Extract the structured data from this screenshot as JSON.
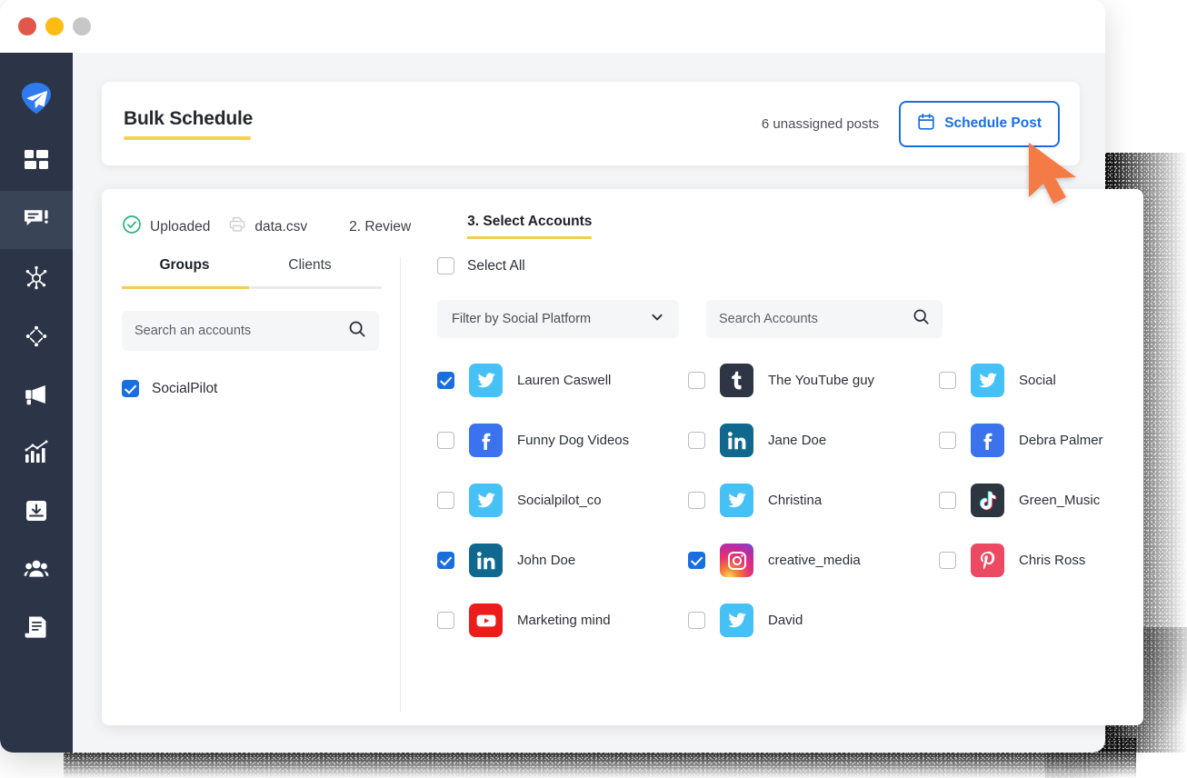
{
  "window": {
    "traffic_lights": [
      {
        "name": "close",
        "color": "#e2574c"
      },
      {
        "name": "minimize",
        "color": "#fdbc13"
      },
      {
        "name": "maximize",
        "color": "#c7c7c7"
      }
    ]
  },
  "sidebar": {
    "items": [
      {
        "icon": "paper-plane-logo-icon",
        "label": "SocialPilot",
        "active": false
      },
      {
        "icon": "dashboard-grid-icon",
        "label": "Dashboard",
        "active": false
      },
      {
        "icon": "posts-comment-icon",
        "label": "Posts",
        "active": true
      },
      {
        "icon": "network-nodes-icon",
        "label": "Connections",
        "active": false
      },
      {
        "icon": "diamond-nodes-icon",
        "label": "Curation",
        "active": false
      },
      {
        "icon": "megaphone-icon",
        "label": "Campaigns",
        "active": false
      },
      {
        "icon": "analytics-bar-chart-icon",
        "label": "Analytics",
        "active": false
      },
      {
        "icon": "inbox-download-icon",
        "label": "Inbox",
        "active": false
      },
      {
        "icon": "team-users-icon",
        "label": "Team",
        "active": false
      },
      {
        "icon": "document-list-icon",
        "label": "Reports",
        "active": false
      }
    ]
  },
  "header": {
    "title": "Bulk Schedule",
    "unassigned_text": "6 unassigned posts",
    "schedule_button": {
      "label": "Schedule Post",
      "icon": "calendar-icon",
      "color": "#1a6fe0"
    },
    "accent_underline_color": "#f7cf52"
  },
  "steps": [
    {
      "id": "uploaded",
      "label": "Uploaded",
      "icon": "check-circle-icon",
      "state": "done"
    },
    {
      "id": "file",
      "label": "data.csv",
      "icon": "printer-file-icon",
      "state": "info"
    },
    {
      "id": "review",
      "label": "2. Review",
      "icon": "",
      "state": "default"
    },
    {
      "id": "select-accounts",
      "label": "3. Select Accounts",
      "icon": "",
      "state": "current"
    }
  ],
  "left_pane": {
    "tabs": [
      {
        "id": "groups",
        "label": "Groups",
        "active": true
      },
      {
        "id": "clients",
        "label": "Clients",
        "active": false
      }
    ],
    "search": {
      "value": "",
      "placeholder": "Search an accounts",
      "icon": "search-icon"
    },
    "groups": [
      {
        "label": "SocialPilot",
        "checked": true
      }
    ]
  },
  "right_pane": {
    "select_all": {
      "label": "Select All",
      "checked": false
    },
    "platform_filter": {
      "value": "Filter by Social Platform",
      "icon": "chevron-down-icon"
    },
    "account_search": {
      "value": "",
      "placeholder": "Search Accounts",
      "icon": "search-icon"
    },
    "accounts": [
      {
        "name": "Lauren Caswell",
        "platform": "twitter",
        "checked": true
      },
      {
        "name": "The YouTube guy",
        "platform": "tumblr",
        "checked": false
      },
      {
        "name": "Social",
        "platform": "twitter",
        "checked": false
      },
      {
        "name": "Funny Dog Videos",
        "platform": "facebook",
        "checked": false
      },
      {
        "name": "Jane Doe",
        "platform": "linkedin",
        "checked": false
      },
      {
        "name": "Debra Palmer",
        "platform": "facebook",
        "checked": false
      },
      {
        "name": "Socialpilot_co",
        "platform": "twitter",
        "checked": false
      },
      {
        "name": "Christina",
        "platform": "twitter",
        "checked": false
      },
      {
        "name": "Green_Music",
        "platform": "tiktok",
        "checked": false
      },
      {
        "name": "John Doe",
        "platform": "linkedin",
        "checked": true
      },
      {
        "name": "creative_media",
        "platform": "instagram",
        "checked": true
      },
      {
        "name": "Chris Ross",
        "platform": "pinterest",
        "checked": false
      },
      {
        "name": "Marketing mind",
        "platform": "youtube",
        "checked": false
      },
      {
        "name": "David",
        "platform": "twitter",
        "checked": false
      }
    ]
  },
  "cursor": {
    "icon": "arrow-cursor-icon",
    "color": "#f47b45"
  }
}
